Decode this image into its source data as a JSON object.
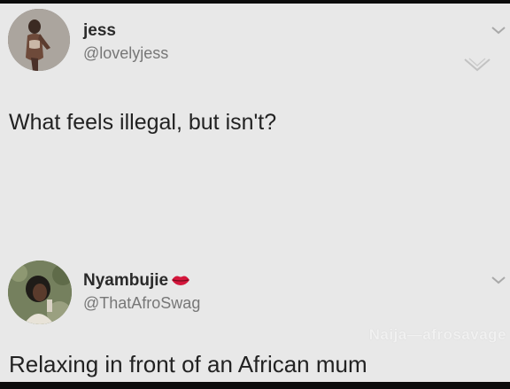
{
  "tweets": [
    {
      "name": "jess",
      "handle": "@lovelyjess",
      "text": "What feels illegal, but isn't?",
      "avatar_icon": "profile-photo",
      "menu_icon": "chevron-down-icon"
    },
    {
      "name": "Nyambujie",
      "name_emoji_icon": "lips-icon",
      "handle": "@ThatAfroSwag",
      "text": "Relaxing in front of an African mum",
      "avatar_icon": "profile-photo",
      "menu_icon": "chevron-down-icon"
    }
  ],
  "watermark": "Naija—afrosavage",
  "colors": {
    "background": "#e8e8e8",
    "name": "#2a2a2a",
    "handle": "#777777",
    "body_text": "#222222",
    "lips": "#d4173c"
  }
}
